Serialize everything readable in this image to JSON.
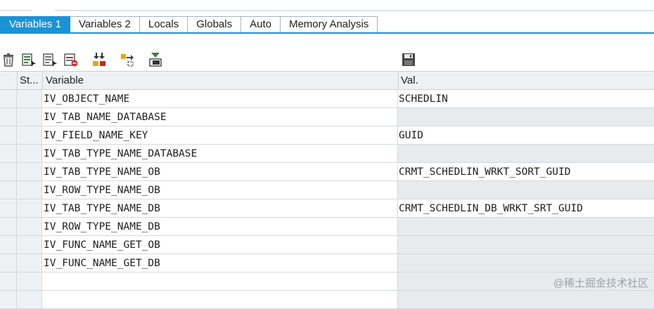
{
  "tabs": [
    {
      "label": "Variables 1",
      "active": true
    },
    {
      "label": "Variables 2",
      "active": false
    },
    {
      "label": "Locals",
      "active": false
    },
    {
      "label": "Globals",
      "active": false
    },
    {
      "label": "Auto",
      "active": false
    },
    {
      "label": "Memory Analysis",
      "active": false
    }
  ],
  "toolbar": {
    "icons": [
      "trash-icon",
      "variable-detail-icon",
      "variable-edit-icon",
      "delete-row-icon",
      "merge-icon",
      "transfer-icon",
      "download-icon",
      "save-icon"
    ]
  },
  "grid": {
    "headers": {
      "status": "St...",
      "variable": "Variable",
      "value": "Val."
    },
    "rows": [
      {
        "variable": "IV_OBJECT_NAME",
        "value": "SCHEDLIN"
      },
      {
        "variable": "IV_TAB_NAME_DATABASE",
        "value": ""
      },
      {
        "variable": "IV_FIELD_NAME_KEY",
        "value": "GUID"
      },
      {
        "variable": "IV_TAB_TYPE_NAME_DATABASE",
        "value": ""
      },
      {
        "variable": "IV_TAB_TYPE_NAME_OB",
        "value": "CRMT_SCHEDLIN_WRKT_SORT_GUID"
      },
      {
        "variable": "IV_ROW_TYPE_NAME_OB",
        "value": ""
      },
      {
        "variable": "IV_TAB_TYPE_NAME_DB",
        "value": "CRMT_SCHEDLIN_DB_WRKT_SRT_GUID"
      },
      {
        "variable": "IV_ROW_TYPE_NAME_DB",
        "value": ""
      },
      {
        "variable": "IV_FUNC_NAME_GET_OB",
        "value": ""
      },
      {
        "variable": "IV_FUNC_NAME_GET_DB",
        "value": ""
      },
      {
        "variable": "",
        "value": ""
      },
      {
        "variable": "",
        "value": ""
      }
    ]
  },
  "watermark": "@稀土掘金技术社区",
  "colors": {
    "accent": "#1a93d6",
    "header_bg": "#eef1f4",
    "empty_value_bg": "#e8ebee"
  }
}
